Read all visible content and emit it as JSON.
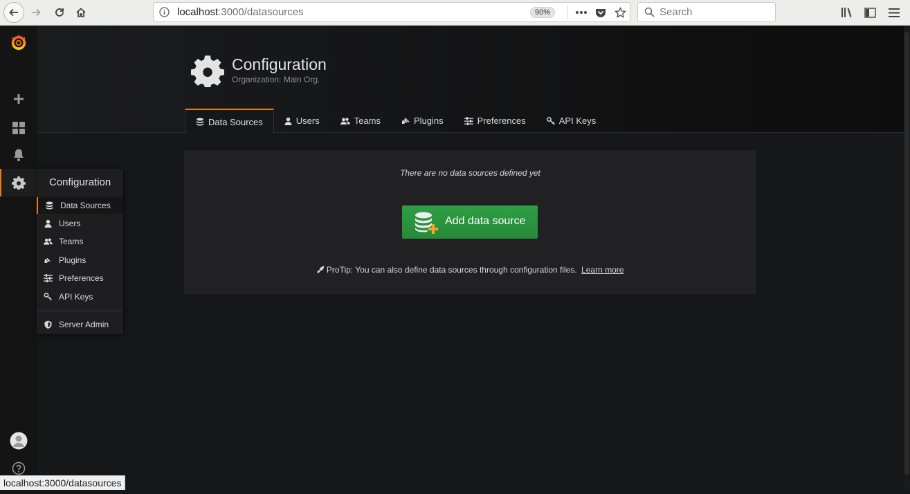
{
  "browser": {
    "url_host": "localhost",
    "url_path": ":3000/datasources",
    "zoom": "90%",
    "search_placeholder": "Search",
    "status_url": "localhost:3000/datasources"
  },
  "header": {
    "title": "Configuration",
    "subtitle": "Organization: Main Org."
  },
  "tabs": [
    {
      "label": "Data Sources",
      "icon": "database-icon"
    },
    {
      "label": "Users",
      "icon": "user-icon"
    },
    {
      "label": "Teams",
      "icon": "users-icon"
    },
    {
      "label": "Plugins",
      "icon": "plug-icon"
    },
    {
      "label": "Preferences",
      "icon": "sliders-icon"
    },
    {
      "label": "API Keys",
      "icon": "key-icon"
    }
  ],
  "panel": {
    "empty_message": "There are no data sources defined yet",
    "add_button": "Add data source",
    "protip": "ProTip: You can also define data sources through configuration files.",
    "learn_more": "Learn more"
  },
  "flyout": {
    "title": "Configuration",
    "items": [
      {
        "label": "Data Sources",
        "icon": "database-icon"
      },
      {
        "label": "Users",
        "icon": "user-icon"
      },
      {
        "label": "Teams",
        "icon": "users-icon"
      },
      {
        "label": "Plugins",
        "icon": "plug-icon"
      },
      {
        "label": "Preferences",
        "icon": "sliders-icon"
      },
      {
        "label": "API Keys",
        "icon": "key-icon"
      },
      {
        "label": "Server Admin",
        "icon": "shield-icon"
      }
    ]
  },
  "colors": {
    "accent": "#eb7b18",
    "button_green": "#299c46",
    "background": "#161719"
  }
}
